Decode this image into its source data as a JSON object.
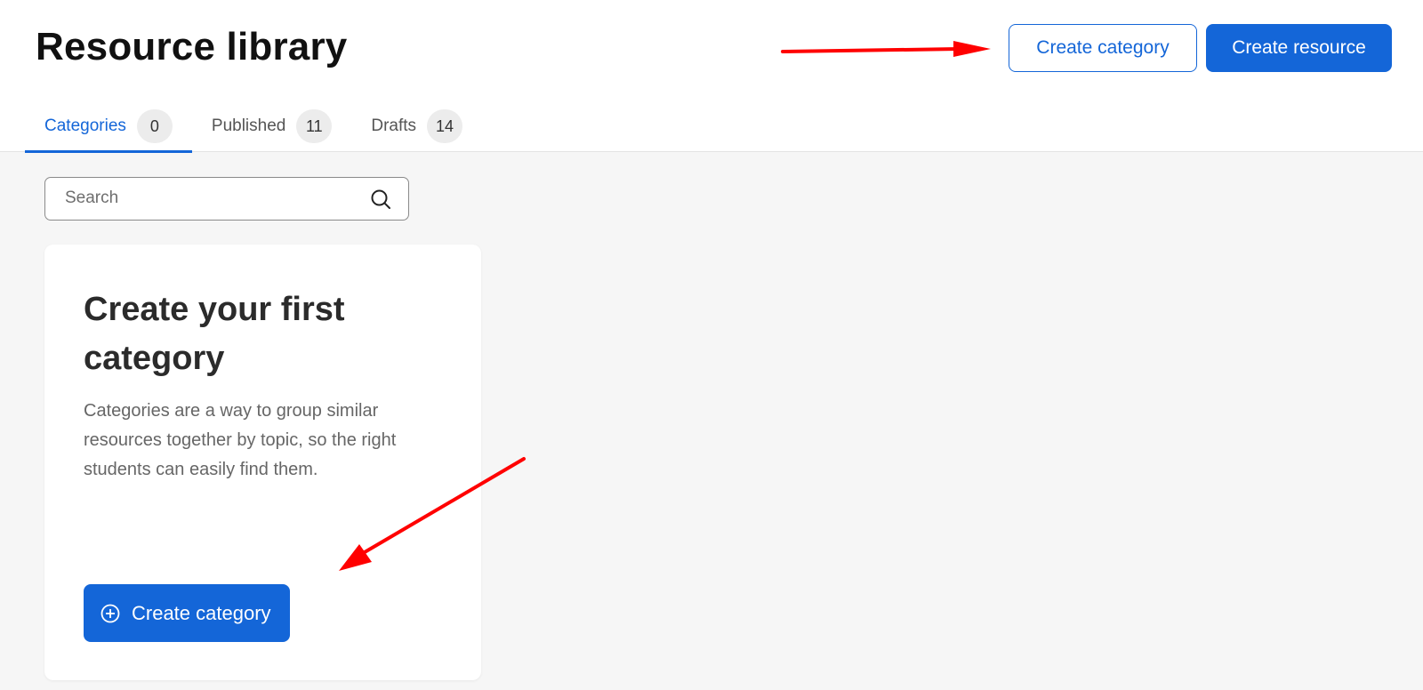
{
  "header": {
    "title": "Resource library",
    "create_category_label": "Create category",
    "create_resource_label": "Create resource"
  },
  "tabs": [
    {
      "label": "Categories",
      "count": "0",
      "active": true
    },
    {
      "label": "Published",
      "count": "11",
      "active": false
    },
    {
      "label": "Drafts",
      "count": "14",
      "active": false
    }
  ],
  "search": {
    "placeholder": "Search",
    "value": ""
  },
  "empty_card": {
    "title": "Create your first category",
    "description": "Categories are a way to group similar resources together by topic, so the right students can easily find them.",
    "button_label": "Create category"
  },
  "icons": {
    "search": "search-icon",
    "plus": "plus-circle-icon"
  },
  "colors": {
    "accent": "#1466d8",
    "annotation": "#ff0000",
    "background": "#f6f6f6"
  }
}
